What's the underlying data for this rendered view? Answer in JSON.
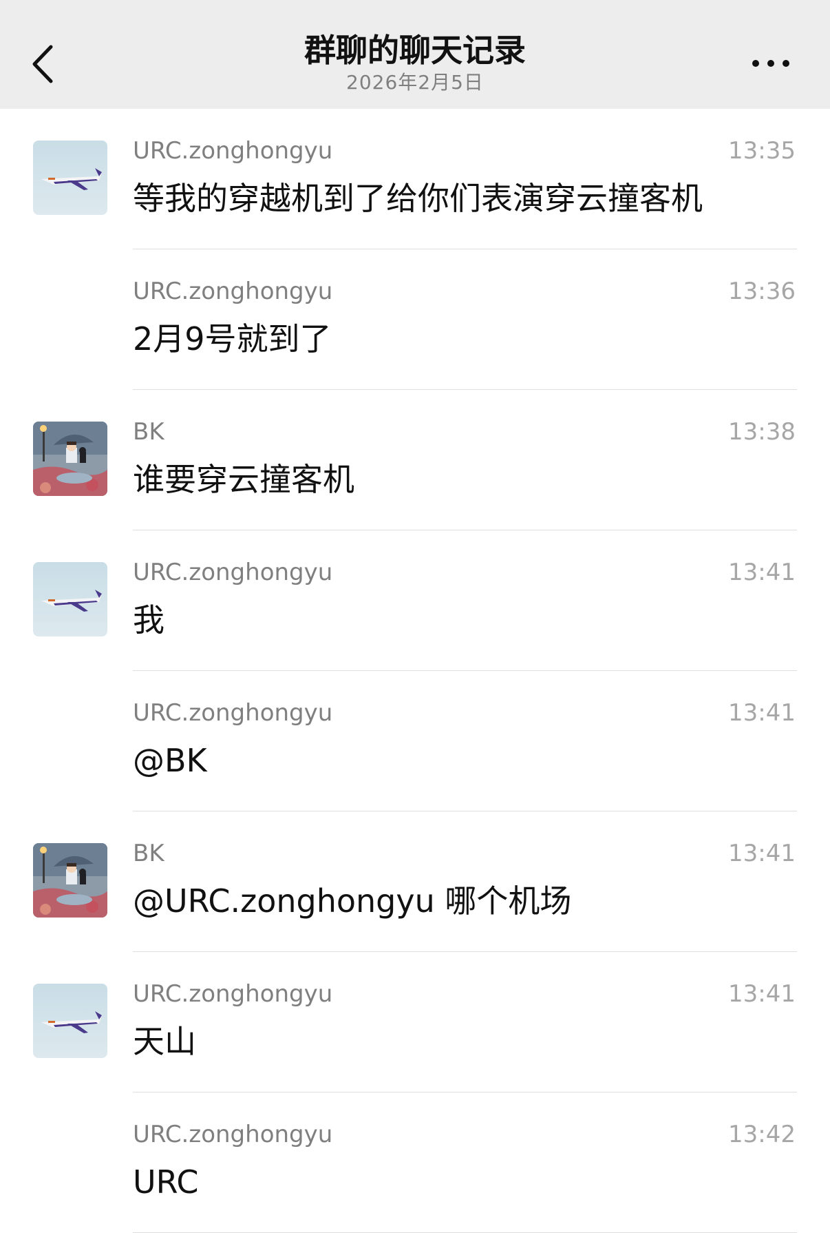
{
  "header": {
    "title": "群聊的聊天记录",
    "date": "2026年2月5日",
    "back_icon": "chevron-left-icon",
    "more_icon": "more-horizontal-icon"
  },
  "messages": [
    {
      "sender": "URC.zonghongyu",
      "time": "13:35",
      "text": "等我的穿越机到了给你们表演穿云撞客机",
      "avatar": "plane"
    },
    {
      "sender": "URC.zonghongyu",
      "time": "13:36",
      "text": "2月9号就到了",
      "avatar": ""
    },
    {
      "sender": "BK",
      "time": "13:38",
      "text": "谁要穿云撞客机",
      "avatar": "umbrella"
    },
    {
      "sender": "URC.zonghongyu",
      "time": "13:41",
      "text": "我",
      "avatar": "plane"
    },
    {
      "sender": "URC.zonghongyu",
      "time": "13:41",
      "text": "@BK",
      "avatar": ""
    },
    {
      "sender": "BK",
      "time": "13:41",
      "text": "@URC.zonghongyu 哪个机场",
      "avatar": "umbrella"
    },
    {
      "sender": "URC.zonghongyu",
      "time": "13:41",
      "text": "天山",
      "avatar": "plane"
    },
    {
      "sender": "URC.zonghongyu",
      "time": "13:42",
      "text": "URC",
      "avatar": ""
    }
  ]
}
